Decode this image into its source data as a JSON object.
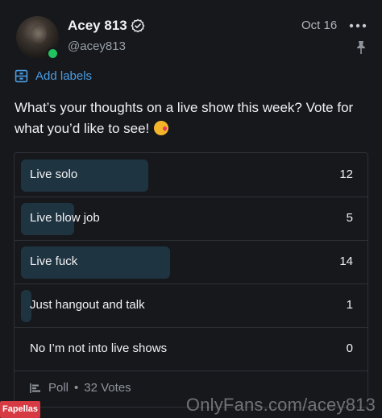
{
  "header": {
    "name": "Acey 813",
    "handle": "@acey813",
    "date": "Oct 16"
  },
  "labels": {
    "add_labels": "Add labels"
  },
  "post": {
    "text": "What’s your thoughts on a live show this week? Vote for what you’d like to see!"
  },
  "poll": {
    "options": [
      {
        "label": "Live solo",
        "votes": 12,
        "votes_text": "12",
        "share": 0.375
      },
      {
        "label": "Live blow job",
        "votes": 5,
        "votes_text": "5",
        "share": 0.156
      },
      {
        "label": "Live fuck",
        "votes": 14,
        "votes_text": "14",
        "share": 0.4375
      },
      {
        "label": "Just hangout and talk",
        "votes": 1,
        "votes_text": "1",
        "share": 0.031
      },
      {
        "label": "No I’m not into live shows",
        "votes": 0,
        "votes_text": "0",
        "share": 0.0
      }
    ],
    "footer_label": "Poll",
    "footer_separator": "•",
    "total_votes": "32 Votes"
  },
  "watermark": "OnlyFans.com/acey813",
  "stamp_logo": "Fapellas",
  "colors": {
    "background": "#16181c",
    "accent": "#4a9de4",
    "poll_fill": "#1f3441",
    "online": "#21c45e"
  },
  "icons": [
    "verified-icon",
    "more-dots-icon",
    "pin-icon",
    "labels-icon",
    "poll-icon",
    "kiss-emoji-icon"
  ]
}
